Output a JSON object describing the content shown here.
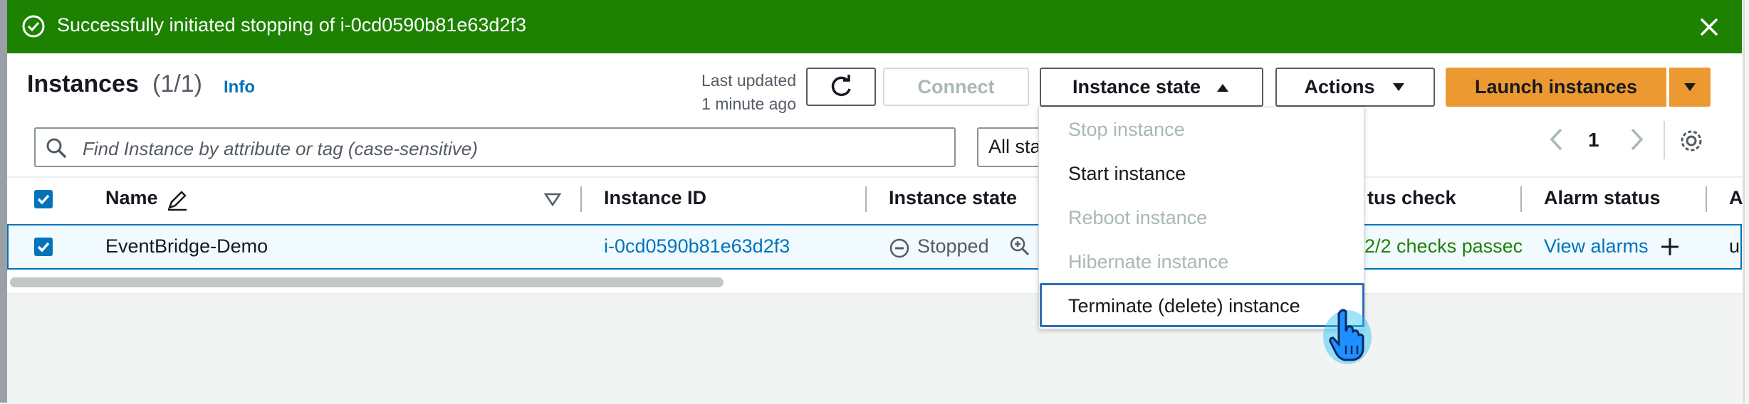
{
  "flash": {
    "message": "Successfully initiated stopping of i-0cd0590b81e63d2f3",
    "status_color": "#1d8102"
  },
  "header": {
    "title": "Instances",
    "count": "(1/1)",
    "info_label": "Info",
    "last_updated_line1": "Last updated",
    "last_updated_line2": "1 minute ago",
    "connect_label": "Connect",
    "instance_state_label": "Instance state",
    "actions_label": "Actions",
    "launch_label": "Launch instances",
    "launch_color": "#ec9932"
  },
  "search": {
    "placeholder": "Find Instance by attribute or tag (case-sensitive)",
    "filter_value": "All sta"
  },
  "pagination": {
    "current_page": "1"
  },
  "table": {
    "columns": [
      "Name",
      "Instance ID",
      "Instance state",
      "tus check",
      "Alarm status",
      "A"
    ],
    "rows": [
      {
        "name": "EventBridge-Demo",
        "instance_id": "i-0cd0590b81e63d2f3",
        "state": "Stopped",
        "status_check": "2/2 checks passec",
        "alarm": "View alarms",
        "az": "u"
      }
    ]
  },
  "instance_state_menu": {
    "items": [
      {
        "label": "Stop instance",
        "enabled": false
      },
      {
        "label": "Start instance",
        "enabled": true
      },
      {
        "label": "Reboot instance",
        "enabled": false
      },
      {
        "label": "Hibernate instance",
        "enabled": false
      },
      {
        "label": "Terminate (delete) instance",
        "enabled": true,
        "hovered": true
      }
    ]
  }
}
